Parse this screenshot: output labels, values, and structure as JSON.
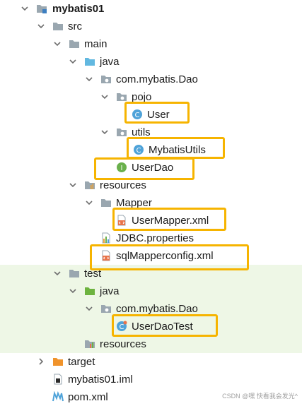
{
  "tree": {
    "project_name": "mybatis01",
    "src": "src",
    "main": "main",
    "java_main": "java",
    "package_main": "com.mybatis.Dao",
    "pojo": "pojo",
    "user_class": "User",
    "utils": "utils",
    "utils_class": "MybatisUtils",
    "dao_interface": "UserDao",
    "resources_main": "resources",
    "mapper_folder": "Mapper",
    "mapper_xml": "UserMapper.xml",
    "jdbc_properties": "JDBC.properties",
    "sql_config": "sqlMapperconfig.xml",
    "test": "test",
    "java_test": "java",
    "package_test": "com.mybatis.Dao",
    "test_class": "UserDaoTest",
    "resources_test": "resources",
    "target": "target",
    "iml_file": "mybatis01.iml",
    "pom_file": "pom.xml"
  },
  "class_icon_letter": "C",
  "interface_icon_letter": "I",
  "watermark": "CSDN @嘿 快看我会发光^",
  "colors": {
    "highlight": "#f6b400",
    "folder": "#9aa7b0",
    "source_folder": "#62b8e0",
    "test_folder": "#6db33f",
    "excluded_folder": "#f0932b",
    "class_icon": "#4fa3d9",
    "interface_icon": "#6ab04c",
    "xml_icon": "#e8734a"
  }
}
